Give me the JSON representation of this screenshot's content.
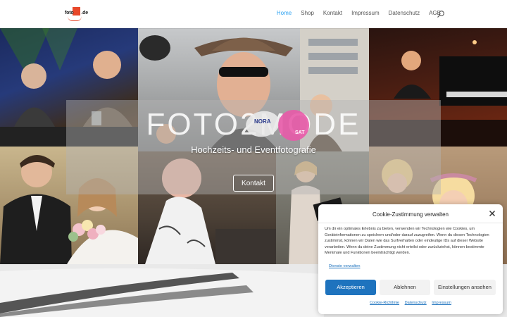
{
  "header": {
    "logo_text": "foto",
    "logo_suffix": ".de",
    "nav": [
      {
        "label": "Home",
        "active": true
      },
      {
        "label": "Shop",
        "active": false
      },
      {
        "label": "Kontakt",
        "active": false
      },
      {
        "label": "Impressum",
        "active": false
      },
      {
        "label": "Datenschutz",
        "active": false
      },
      {
        "label": "AGB",
        "active": false
      }
    ],
    "search_icon": "search-icon"
  },
  "hero": {
    "title": "FOTO2MODE",
    "subtitle": "Hochzeits- und Eventfotografie",
    "button_label": "Kontakt",
    "badge_1": "NORA",
    "badge_2": "SAT"
  },
  "cookie": {
    "title": "Cookie-Zustimmung verwalten",
    "text": "Um dir ein optimales Erlebnis zu bieten, verwenden wir Technologien wie Cookies, um Geräteinformationen zu speichern und/oder darauf zuzugreifen. Wenn du diesen Technologien zustimmst, können wir Daten wie das Surfverhalten oder eindeutige IDs auf dieser Website verarbeiten. Wenn du deine Zustimmung nicht erteilst oder zurückziehst, können bestimmte Merkmale und Funktionen beeinträchtigt werden.",
    "manage_link": "Dienste verwalten",
    "accept_label": "Akzeptieren",
    "deny_label": "Ablehnen",
    "settings_label": "Einstellungen ansehen",
    "footer_links": [
      "Cookie-Richtlinie",
      "Datenschutz",
      "Impressum"
    ]
  },
  "colors": {
    "accent": "#2ea3f2",
    "button_blue": "#1e73be",
    "logo_red": "#e8482a"
  }
}
